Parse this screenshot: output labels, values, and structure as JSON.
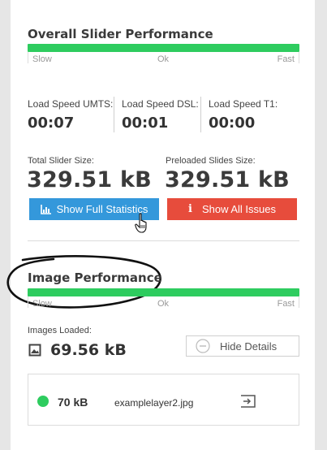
{
  "overall": {
    "title": "Overall Slider Performance",
    "scale": {
      "slow": "Slow",
      "ok": "Ok",
      "fast": "Fast"
    },
    "performance_level": 1.0,
    "bar_color": "#2ecc5f"
  },
  "load_speeds": [
    {
      "label": "Load Speed UMTS:",
      "value": "00:07"
    },
    {
      "label": "Load Speed DSL:",
      "value": "00:01"
    },
    {
      "label": "Load Speed T1:",
      "value": "00:00"
    }
  ],
  "sizes": {
    "total_label": "Total Slider Size:",
    "total_value": "329.51 kB",
    "preloaded_label": "Preloaded Slides Size:",
    "preloaded_value": "329.51 kB"
  },
  "buttons": {
    "stats_label": "Show Full Statistics",
    "stats_icon": "bar-chart-icon",
    "issues_label": "Show All Issues",
    "issues_icon": "info-icon",
    "blue": "#3498db",
    "red": "#e74c3c"
  },
  "image": {
    "title": "Image Performance",
    "scale": {
      "slow": "Slow",
      "ok": "Ok",
      "fast": "Fast"
    },
    "performance_level": 1.0,
    "loaded_label": "Images Loaded:",
    "loaded_value": "69.56 kB",
    "loaded_icon": "image-icon",
    "hide_details_label": "Hide Details",
    "hide_details_icon": "minus-circle-icon"
  },
  "files": [
    {
      "status_color": "#2ecc5f",
      "size": "70 kB",
      "name": "examplelayer2.jpg",
      "action_icon": "open-external-icon"
    }
  ]
}
